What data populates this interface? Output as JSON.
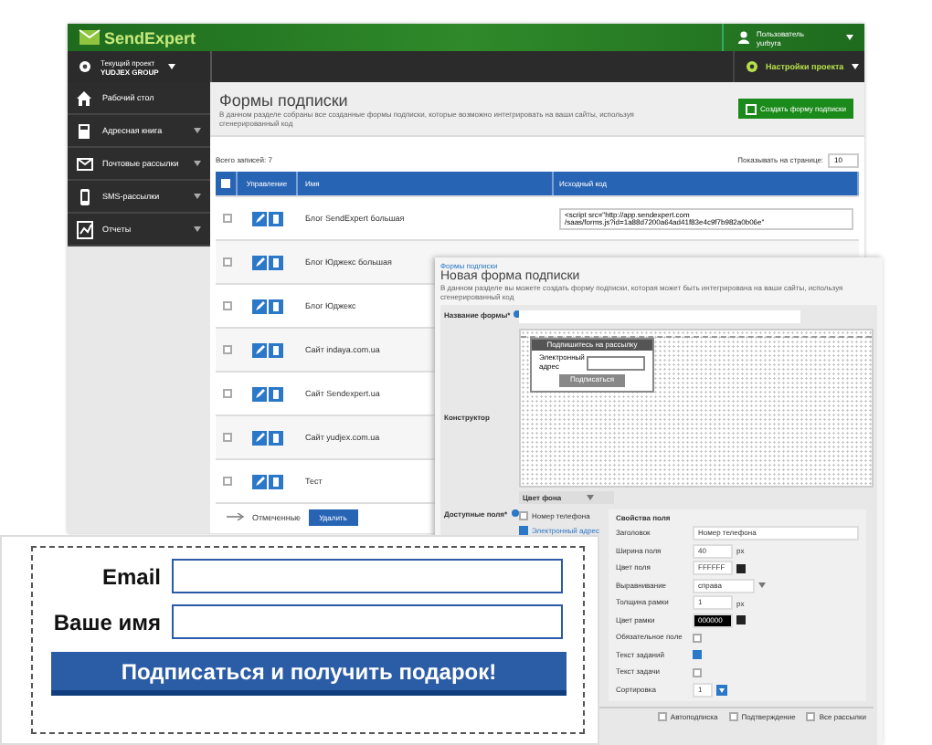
{
  "app": {
    "logo": "SendExpert",
    "user_label": "Пользователь",
    "user_name": "yurbyra",
    "project_label": "Текущий проект",
    "project_name": "YUDJEX GROUP",
    "settings_label": "Настройки проекта",
    "sidebar": [
      {
        "label": "Рабочий стол",
        "expandable": false
      },
      {
        "label": "Адресная книга",
        "expandable": true
      },
      {
        "label": "Почтовые рассылки",
        "expandable": true
      },
      {
        "label": "SMS-рассылки",
        "expandable": true
      },
      {
        "label": "Отчеты",
        "expandable": true
      }
    ],
    "page_title": "Формы подписки",
    "description": "В данном разделе собраны все созданные формы подписки, которые возможно интегрировать на ваши сайты, используя сгенерированный код",
    "create_button": "Создать форму подписки",
    "total": "Всего записей: 7",
    "per_page_label": "Показывать на странице:",
    "per_page_value": "10",
    "select_all_checked": false,
    "columns": [
      "Управление",
      "Имя",
      "Исходный код"
    ],
    "rows": [
      {
        "name": "Блог SendExpert большая",
        "code": "<script src=\"http://app.sendexpert.com\n/saas/forms.js?id=1a88d7200a64ad41f83e4c9f7b982a0b06e\"",
        "checked": false
      },
      {
        "name": "Блог Юджекс большая",
        "checked": false
      },
      {
        "name": "Блог Юджекс",
        "checked": false
      },
      {
        "name": "Сайт indaya.com.ua",
        "checked": false
      },
      {
        "name": "Сайт Sendexpert.ua",
        "checked": false
      },
      {
        "name": "Сайт yudjex.com.ua",
        "checked": false
      },
      {
        "name": "Тест",
        "checked": false
      }
    ],
    "bulk_label": "Отмеченные",
    "delete_button": "Удалить"
  },
  "form_editor": {
    "breadcrumb": "Формы подписки",
    "title": "Новая форма подписки",
    "description": "В данном разделе вы можете создать форму подписки, которая может быть интегрирована на ваши сайты, используя сгенерированный код",
    "name_label": "Название формы*",
    "constructor_label": "Конструктор",
    "mini_form": {
      "title": "Подпишитесь на рассылку",
      "field": "Электронный адрес",
      "button": "Подписаться"
    },
    "bg_color_label": "Цвет фона",
    "fields_label": "Доступные поля*",
    "available_fields": [
      {
        "label": "Номер телефона",
        "checked": false
      },
      {
        "label": "Электронный адрес",
        "checked": true
      }
    ],
    "properties_title": "Свойства поля",
    "properties": [
      {
        "label": "Заголовок",
        "kind": "input",
        "value": "Номер телефона"
      },
      {
        "label": "Ширина поля",
        "kind": "input",
        "value": "40",
        "unit": "px"
      },
      {
        "label": "Цвет поля",
        "kind": "color",
        "value": "FFFFFF",
        "color": "#ffffff"
      },
      {
        "label": "Выравнивание",
        "kind": "select",
        "value": "справа"
      },
      {
        "label": "Толщина рамки",
        "kind": "input",
        "value": "1",
        "unit": "px"
      },
      {
        "label": "Цвет рамки",
        "kind": "color",
        "value": "000000",
        "color": "#000000"
      },
      {
        "label": "Обязательное поле",
        "kind": "check",
        "checked": false
      },
      {
        "label": "Текст заданий",
        "kind": "check",
        "checked": true
      },
      {
        "label": "Текст задачи",
        "kind": "check",
        "checked": false
      },
      {
        "label": "Сортировка",
        "kind": "sort",
        "value": "1"
      }
    ],
    "options": [
      {
        "label": "Автоподписка",
        "checked": false
      },
      {
        "label": "Подтверждение",
        "checked": false
      },
      {
        "label": "Все рассылки",
        "checked": false
      }
    ]
  },
  "preview": {
    "fields": [
      "Email",
      "Ваше имя"
    ],
    "submit": "Подписаться и получить подарок!"
  }
}
